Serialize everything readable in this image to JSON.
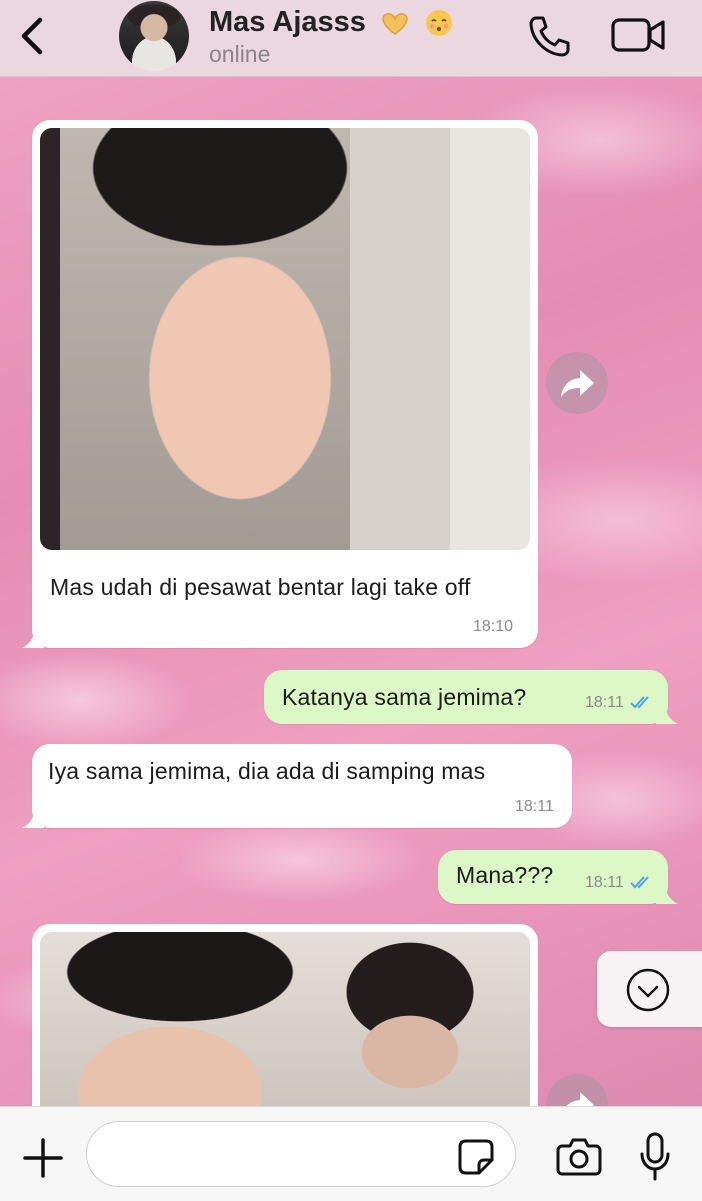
{
  "header": {
    "contact_name": "Mas Ajasss",
    "status": "online",
    "icons": [
      "back-icon",
      "contact-avatar",
      "heart-hands-emoji",
      "kissing-emoji",
      "phone-call-icon",
      "video-call-icon"
    ]
  },
  "messages": [
    {
      "direction": "in",
      "type": "image",
      "caption": "Mas udah di pesawat bentar lagi take off",
      "time": "18:10"
    },
    {
      "direction": "out",
      "text": "Katanya sama jemima?",
      "time": "18:11",
      "read": true
    },
    {
      "direction": "in",
      "text": "Iya sama jemima, dia ada di samping mas",
      "time": "18:11"
    },
    {
      "direction": "out",
      "text": "Mana???",
      "time": "18:11",
      "read": true
    },
    {
      "direction": "in",
      "type": "image",
      "caption": "",
      "time": ""
    }
  ],
  "input": {
    "placeholder": "",
    "icons": [
      "plus-icon",
      "sticker-icon",
      "camera-icon",
      "microphone-icon"
    ]
  },
  "colors": {
    "header_bg": "#ebd7df",
    "incoming_bubble": "#ffffff",
    "outgoing_bubble": "#dcf8c6",
    "read_ticks": "#4fa3e6",
    "wallpaper": "#e79bbb"
  }
}
